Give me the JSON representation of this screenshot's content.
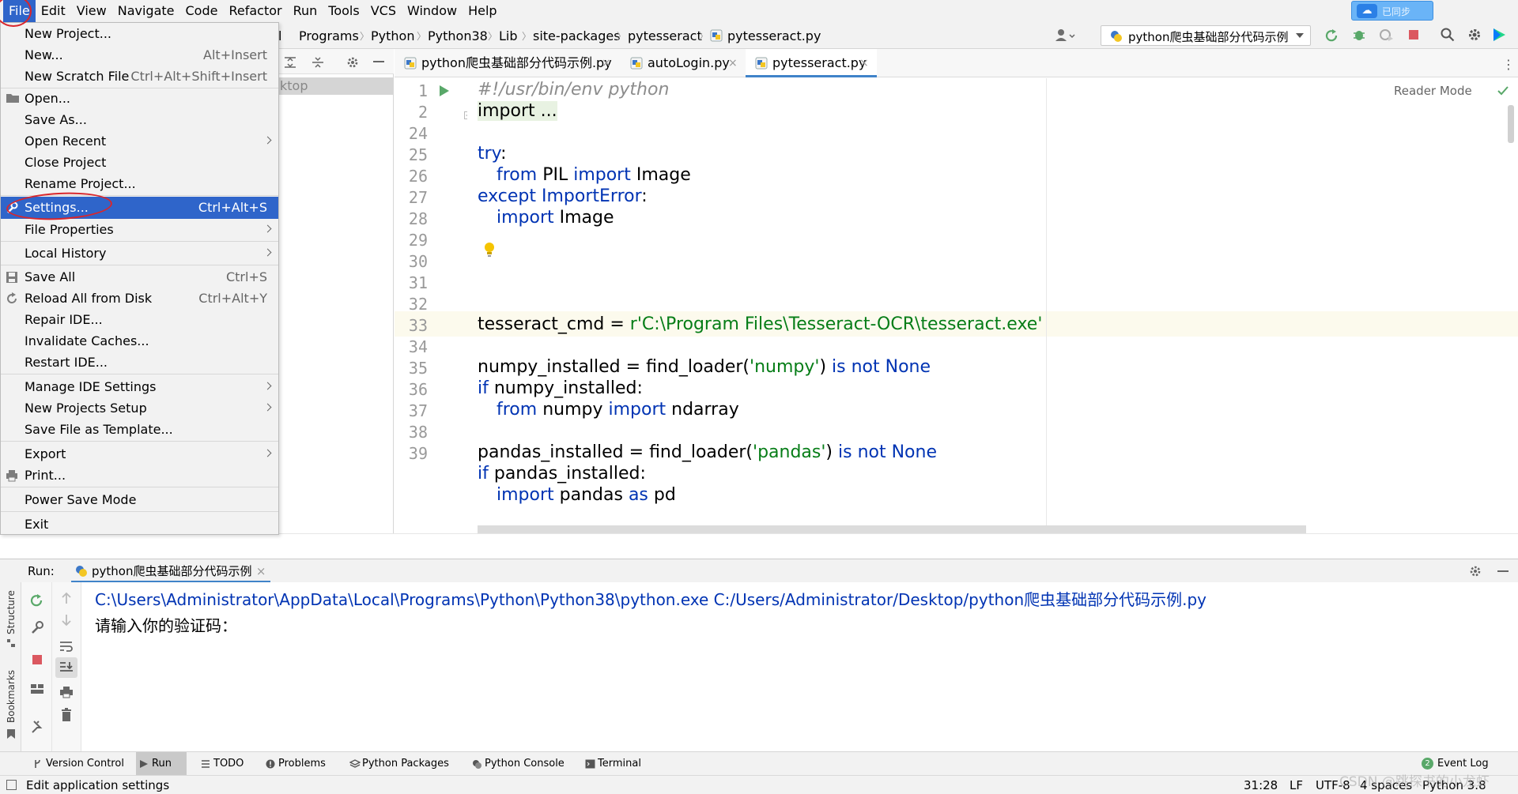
{
  "menubar": {
    "items": [
      "File",
      "Edit",
      "View",
      "Navigate",
      "Code",
      "Refactor",
      "Run",
      "Tools",
      "VCS",
      "Window",
      "Help"
    ],
    "cloud_badge": "已同步"
  },
  "breadcrumbs": [
    "l",
    "Programs",
    "Python",
    "Python38",
    "Lib",
    "site-packages",
    "pytesseract",
    "pytesseract.py"
  ],
  "run_config": {
    "label": "python爬虫基础部分代码示例"
  },
  "project_panel": {
    "row_text": "ktop"
  },
  "editor": {
    "tabs": [
      {
        "label": "python爬虫基础部分代码示例.py"
      },
      {
        "label": "autoLogin.py"
      },
      {
        "label": "pytesseract.py"
      }
    ],
    "reader_mode": "Reader Mode",
    "line_numbers": [
      "1",
      "2",
      "24",
      "25",
      "26",
      "27",
      "28",
      "29",
      "30",
      "31",
      "32",
      "33",
      "34",
      "35",
      "36",
      "37",
      "38",
      "39"
    ],
    "lines": {
      "l1": "#!/usr/bin/env python",
      "l2": "import ...",
      "l25_kw": "try",
      "l25_p": ":",
      "l26_kw1": "from",
      "l26_t1": " PIL ",
      "l26_kw2": "import",
      "l26_t2": " Image",
      "l27_kw": "except",
      "l27_t": " ImportError",
      "l27_p": ":",
      "l28_kw": "import",
      "l28_t": " Image",
      "l31_t": "tesseract_cmd = ",
      "l31_s": "r'C:\\Program Files\\Tesseract-OCR\\tesseract.exe'",
      "l33_t": "numpy_installed = find_loader(",
      "l33_s": "'numpy'",
      "l33_p": ") ",
      "l33_kw": "is not None",
      "l34_kw": "if",
      "l34_t": " numpy_installed:",
      "l35_kw1": "from",
      "l35_t1": " numpy ",
      "l35_kw2": "import",
      "l35_t2": " ndarray",
      "l37_t": "pandas_installed = find_loader(",
      "l37_s": "'pandas'",
      "l37_p": ") ",
      "l37_kw": "is not None",
      "l38_kw": "if",
      "l38_t": " pandas_installed:",
      "l39_kw1": "import",
      "l39_t": " pandas ",
      "l39_kw2": "as",
      "l39_t2": " pd"
    }
  },
  "file_menu": {
    "items": [
      {
        "label": "New Project...",
        "shortcut": ""
      },
      {
        "label": "New...",
        "shortcut": "Alt+Insert"
      },
      {
        "label": "New Scratch File",
        "shortcut": "Ctrl+Alt+Shift+Insert"
      },
      {
        "label": "Open...",
        "shortcut": ""
      },
      {
        "label": "Save As...",
        "shortcut": ""
      },
      {
        "label": "Open Recent",
        "shortcut": ""
      },
      {
        "label": "Close Project",
        "shortcut": ""
      },
      {
        "label": "Rename Project...",
        "shortcut": ""
      },
      {
        "label": "Settings...",
        "shortcut": "Ctrl+Alt+S"
      },
      {
        "label": "File Properties",
        "shortcut": ""
      },
      {
        "label": "Local History",
        "shortcut": ""
      },
      {
        "label": "Save All",
        "shortcut": "Ctrl+S"
      },
      {
        "label": "Reload All from Disk",
        "shortcut": "Ctrl+Alt+Y"
      },
      {
        "label": "Repair IDE...",
        "shortcut": ""
      },
      {
        "label": "Invalidate Caches...",
        "shortcut": ""
      },
      {
        "label": "Restart IDE...",
        "shortcut": ""
      },
      {
        "label": "Manage IDE Settings",
        "shortcut": ""
      },
      {
        "label": "New Projects Setup",
        "shortcut": ""
      },
      {
        "label": "Save File as Template...",
        "shortcut": ""
      },
      {
        "label": "Export",
        "shortcut": ""
      },
      {
        "label": "Print...",
        "shortcut": ""
      },
      {
        "label": "Power Save Mode",
        "shortcut": ""
      },
      {
        "label": "Exit",
        "shortcut": ""
      }
    ]
  },
  "run_window": {
    "label": "Run:",
    "tab": "python爬虫基础部分代码示例",
    "console": [
      "C:\\Users\\Administrator\\AppData\\Local\\Programs\\Python\\Python38\\python.exe C:/Users/Administrator/Desktop/python爬虫基础部分代码示例.py",
      "请输入你的验证码："
    ],
    "side_labels": [
      "Structure",
      "Bookmarks"
    ]
  },
  "tool_tabs": [
    "Version Control",
    "Run",
    "TODO",
    "Problems",
    "Python Packages",
    "Python Console",
    "Terminal"
  ],
  "event_log": {
    "count": "2",
    "label": "Event Log"
  },
  "status": {
    "message": "Edit application settings",
    "position": "31:28",
    "line_sep": "LF",
    "encoding": "UTF-8",
    "indent": "4 spaces",
    "interpreter": "Python 3.8"
  },
  "watermark": "CSDN @跳探书的小龙虾",
  "colors": {
    "accent": "#2f65ca",
    "keyword": "#0033b3",
    "string": "#067d17",
    "annotation": "#d9262c"
  }
}
